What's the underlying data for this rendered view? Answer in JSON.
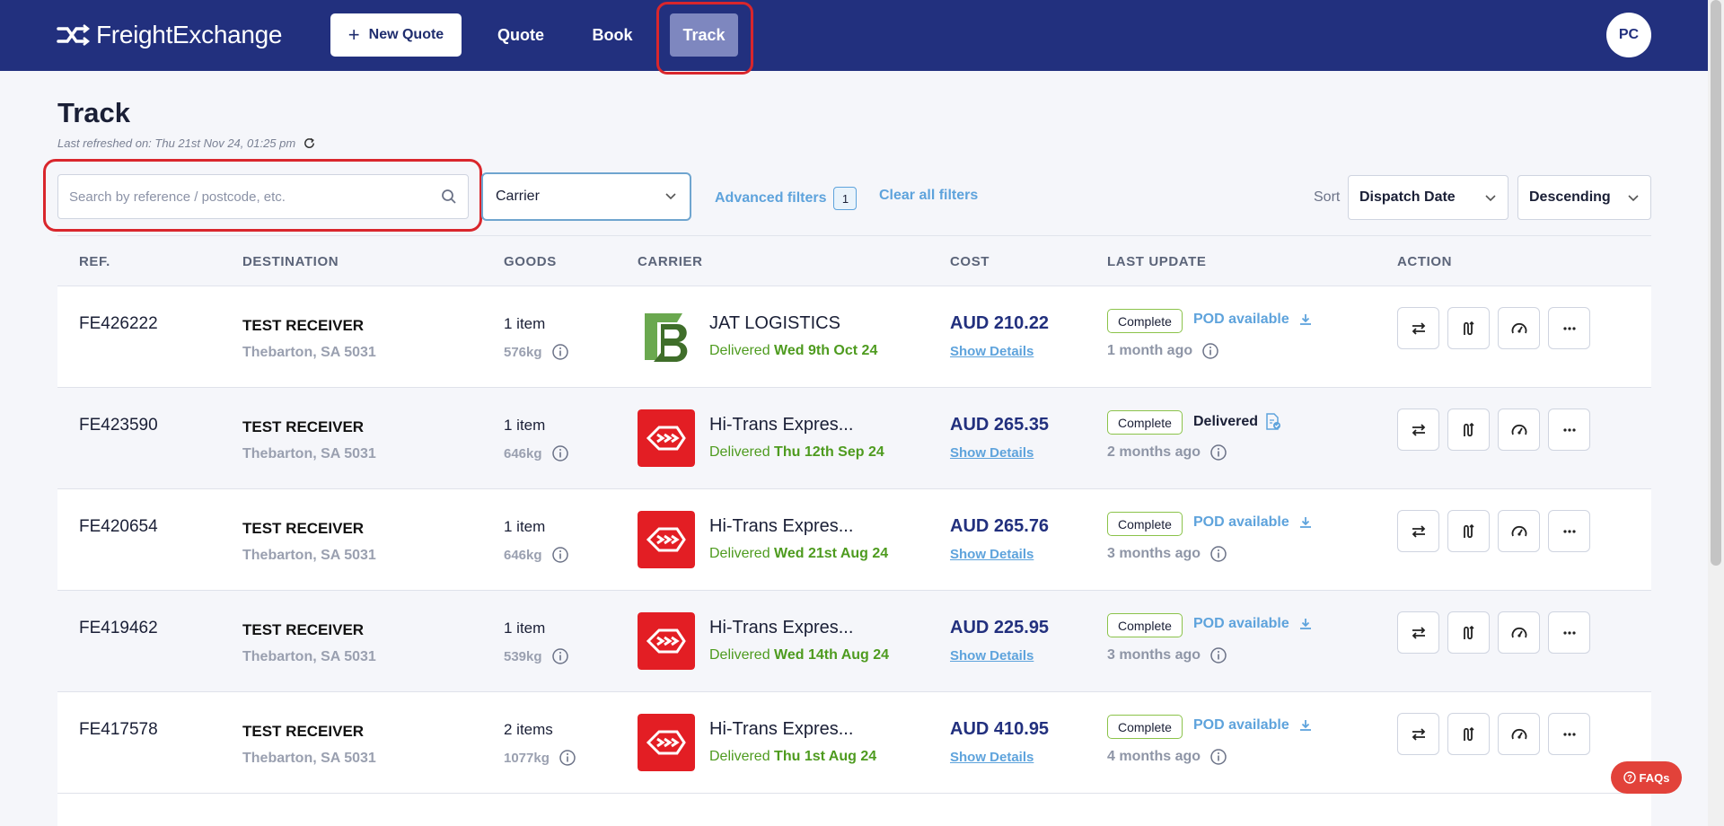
{
  "app": {
    "name": "FreightExchange"
  },
  "nav": {
    "new_quote": "New Quote",
    "quote": "Quote",
    "book": "Book",
    "track": "Track",
    "avatar": "PC"
  },
  "page": {
    "title": "Track",
    "last_refreshed": "Last refreshed on: Thu 21st Nov 24, 01:25 pm"
  },
  "filters": {
    "search_placeholder": "Search by reference / postcode, etc.",
    "carrier_value": "Carrier",
    "advanced_filters": "Advanced filters",
    "advanced_count": "1",
    "clear_all": "Clear all filters",
    "sort_label": "Sort",
    "sort_field": "Dispatch Date",
    "sort_order": "Descending"
  },
  "table": {
    "headers": [
      "REF.",
      "DESTINATION",
      "GOODS",
      "CARRIER",
      "COST",
      "LAST UPDATE",
      "ACTION"
    ],
    "rows": [
      {
        "ref": "FE426222",
        "dest_name": "TEST RECEIVER",
        "dest_addr": "Thebarton, SA 5031",
        "items": "1 item",
        "weight": "576kg",
        "carrier": "JAT LOGISTICS",
        "carrier_logo": "jat",
        "delivered_prefix": "Delivered",
        "delivered_date": "Wed 9th Oct 24",
        "cost": "AUD 210.22",
        "show_details": "Show Details",
        "status": "Complete",
        "doc_label": "POD available",
        "doc_type": "pod",
        "ago": "1 month ago"
      },
      {
        "ref": "FE423590",
        "dest_name": "TEST RECEIVER",
        "dest_addr": "Thebarton, SA 5031",
        "items": "1 item",
        "weight": "646kg",
        "carrier": "Hi-Trans Expres...",
        "carrier_logo": "hitrans",
        "delivered_prefix": "Delivered",
        "delivered_date": "Thu 12th Sep 24",
        "cost": "AUD 265.35",
        "show_details": "Show Details",
        "status": "Complete",
        "doc_label": "Delivered",
        "doc_type": "delivered",
        "ago": "2 months ago"
      },
      {
        "ref": "FE420654",
        "dest_name": "TEST RECEIVER",
        "dest_addr": "Thebarton, SA 5031",
        "items": "1 item",
        "weight": "646kg",
        "carrier": "Hi-Trans Expres...",
        "carrier_logo": "hitrans",
        "delivered_prefix": "Delivered",
        "delivered_date": "Wed 21st Aug 24",
        "cost": "AUD 265.76",
        "show_details": "Show Details",
        "status": "Complete",
        "doc_label": "POD available",
        "doc_type": "pod",
        "ago": "3 months ago"
      },
      {
        "ref": "FE419462",
        "dest_name": "TEST RECEIVER",
        "dest_addr": "Thebarton, SA 5031",
        "items": "1 item",
        "weight": "539kg",
        "carrier": "Hi-Trans Expres...",
        "carrier_logo": "hitrans",
        "delivered_prefix": "Delivered",
        "delivered_date": "Wed 14th Aug 24",
        "cost": "AUD 225.95",
        "show_details": "Show Details",
        "status": "Complete",
        "doc_label": "POD available",
        "doc_type": "pod",
        "ago": "3 months ago"
      },
      {
        "ref": "FE417578",
        "dest_name": "TEST RECEIVER",
        "dest_addr": "Thebarton, SA 5031",
        "items": "2 items",
        "weight": "1077kg",
        "carrier": "Hi-Trans Expres...",
        "carrier_logo": "hitrans",
        "delivered_prefix": "Delivered",
        "delivered_date": "Thu 1st Aug 24",
        "cost": "AUD 410.95",
        "show_details": "Show Details",
        "status": "Complete",
        "doc_label": "POD available",
        "doc_type": "pod",
        "ago": "4 months ago"
      }
    ]
  },
  "faq": {
    "label": "FAQs"
  },
  "colors": {
    "nav_bg": "#22307e",
    "accent": "#5ea3dc",
    "delivered_green": "#4e9b1f",
    "highlight": "#d9262c",
    "hitrans_red": "#e31e24"
  },
  "icons": {
    "search": "search-icon",
    "refresh": "refresh-icon",
    "download": "download-icon",
    "info": "info-icon",
    "document": "document-icon",
    "chevron": "chevron-down-icon"
  }
}
